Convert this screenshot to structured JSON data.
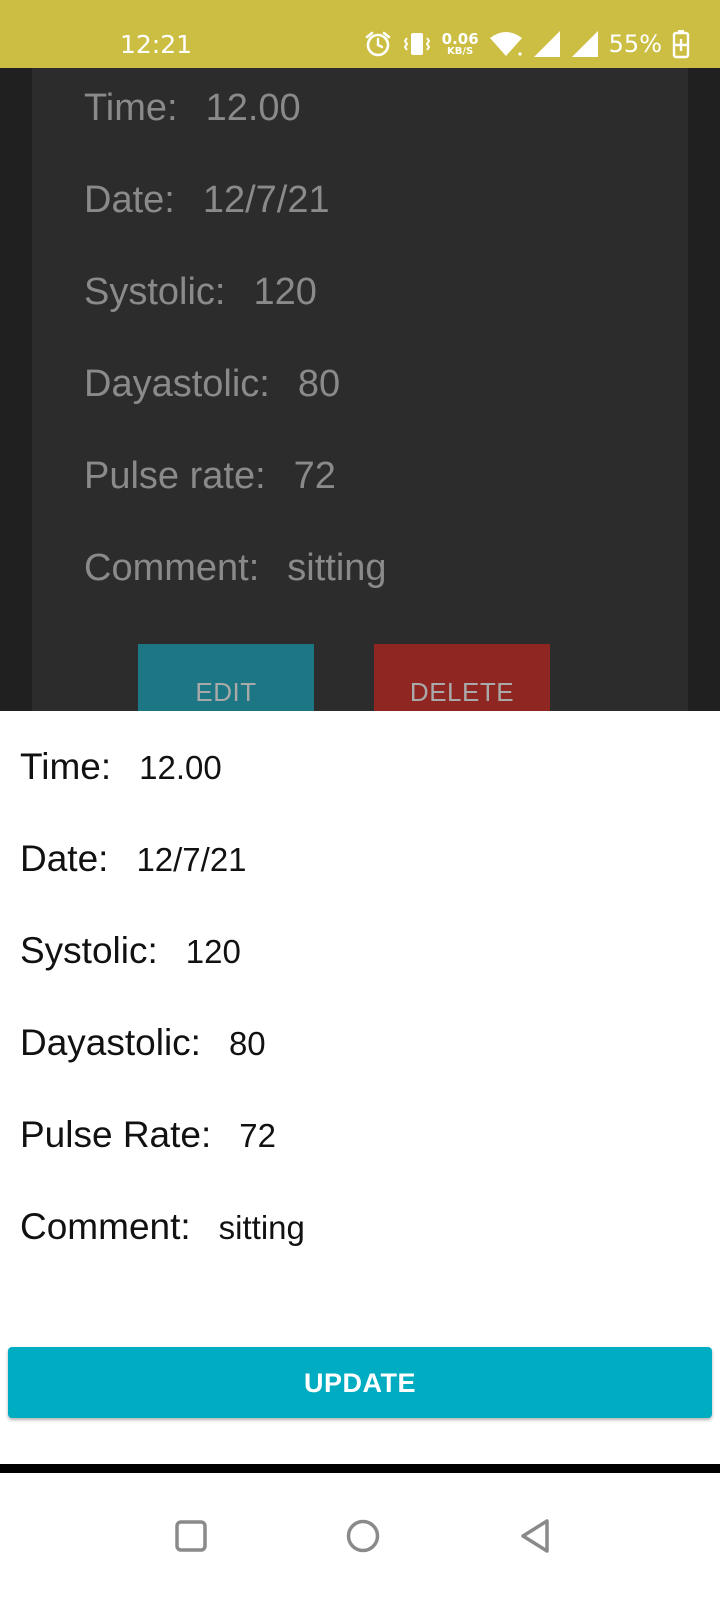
{
  "status_bar": {
    "time": "12:21",
    "net_speed_value": "0.06",
    "net_speed_unit": "KB/S",
    "battery": "55%",
    "icons": [
      "alarm-icon",
      "vibrate-icon",
      "wifi-icon",
      "signal-icon",
      "signal-icon",
      "battery-charging-icon"
    ],
    "bg_color": "#cbbe42"
  },
  "background_card": {
    "rows": [
      {
        "label": "Time:",
        "value": "12.00"
      },
      {
        "label": "Date:",
        "value": "12/7/21"
      },
      {
        "label": "Systolic:",
        "value": "120"
      },
      {
        "label": "Dayastolic:",
        "value": "80"
      },
      {
        "label": "Pulse rate:",
        "value": "72"
      },
      {
        "label": "Comment:",
        "value": "sitting"
      }
    ],
    "edit_label": "EDIT",
    "delete_label": "DELETE",
    "edit_color": "#1c7683",
    "delete_color": "#902622"
  },
  "sheet": {
    "rows": [
      {
        "label": "Time:",
        "value": "12.00"
      },
      {
        "label": "Date:",
        "value": "12/7/21"
      },
      {
        "label": "Systolic:",
        "value": "120"
      },
      {
        "label": "Dayastolic:",
        "value": "80"
      },
      {
        "label": "Pulse Rate:",
        "value": "72"
      },
      {
        "label": "Comment:",
        "value": "sitting"
      }
    ],
    "update_label": "UPDATE",
    "update_color": "#00acc1"
  },
  "nav_bar": {
    "icons": [
      "recents-square-icon",
      "home-circle-icon",
      "back-triangle-icon"
    ]
  }
}
